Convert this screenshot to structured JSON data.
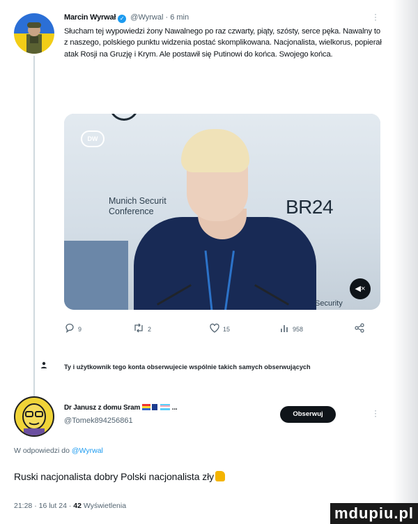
{
  "tweet": {
    "author_name": "Marcin Wyrwał",
    "author_handle": "@Wyrwal",
    "time": "6 min",
    "separator": "·",
    "text": "Słucham tej wypowiedzi żony Nawalnego po raz czwarty, piąty, szósty, serce pęka. Nawalny to z naszego, polskiego punktu widzenia postać skomplikowana. Nacjonalista, wielkorus, popierał atak Rosji na Gruzję i Krym. Ale postawił się Putinowi do końca. Swojego końca.",
    "media": {
      "logo": "DW",
      "conference_line1": "Munich Securit",
      "conference_line2": "Conference",
      "br24": "BR24",
      "security": "Security",
      "mute_icon": "speaker-muted-icon"
    },
    "actions": {
      "replies": "9",
      "reposts": "2",
      "likes": "15",
      "views": "958"
    }
  },
  "follow_note": "Ty i użytkownik tego konta obserwujecie wspólnie takich samych obserwujących",
  "reply": {
    "author_name": "Dr Janusz z domu Sram",
    "flag_suffix": "...",
    "author_handle": "@Tomek894256861",
    "follow_button": "Obserwuj",
    "replying_to_prefix": "W odpowiedzi do ",
    "replying_to_handle": "@Wyrwal",
    "text": "Ruski nacjonalista dobry Polski nacjonalista zły",
    "time": "21:28",
    "date": "16 lut 24",
    "views_count": "42",
    "views_label": "Wyświetlenia"
  },
  "watermark": "mdupiu.pl",
  "colors": {
    "link": "#1d9bf0",
    "muted": "#536471",
    "text": "#0f1419",
    "button": "#0f1419"
  }
}
